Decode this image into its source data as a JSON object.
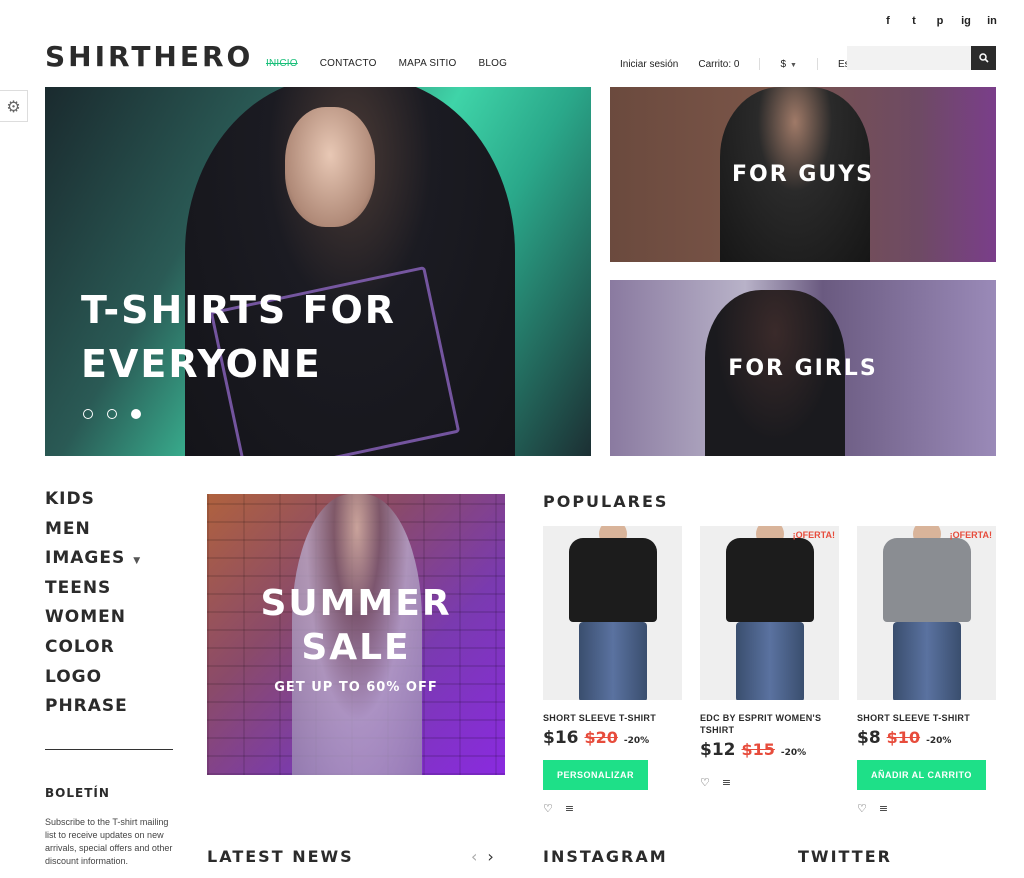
{
  "social": [
    "f",
    "t",
    "p",
    "ig",
    "in"
  ],
  "header": {
    "logo": "SHIRTHERO",
    "nav": [
      "INICIO",
      "CONTACTO",
      "MAPA SITIO",
      "BLOG"
    ],
    "login": "Iniciar sesión",
    "cart": "Carrito: 0",
    "currency": "$",
    "language": "Es",
    "search_placeholder": ""
  },
  "hero": {
    "title_line1": "T-SHIRTS FOR",
    "title_line2": "EVERYONE",
    "slides": 3,
    "active_slide": 3
  },
  "tiles": {
    "guys": "FOR GUYS",
    "girls": "FOR GIRLS"
  },
  "categories": [
    "KIDS",
    "MEN",
    "IMAGES",
    "TEENS",
    "WOMEN",
    "COLOR",
    "LOGO",
    "PHRASE"
  ],
  "newsletter": {
    "title": "BOLETÍN",
    "text": "Subscribe to the T-shirt mailing list to receive updates on new arrivals, special offers and other discount information."
  },
  "sale": {
    "line1": "SUMMER",
    "line2": "SALE",
    "sub": "GET UP TO 60% OFF"
  },
  "populares": {
    "title": "POPULARES",
    "products": [
      {
        "name": "SHORT SLEEVE T-SHIRT",
        "price": "$16",
        "old": "$20",
        "discount": "-20%",
        "badge": "",
        "button": "PERSONALIZAR",
        "shirt_color": "#1c1c1c"
      },
      {
        "name": "EDC BY ESPRIT WOMEN'S TSHIRT",
        "price": "$12",
        "old": "$15",
        "discount": "-20%",
        "badge": "¡OFERTA!",
        "button": "",
        "shirt_color": "#1c1c1c"
      },
      {
        "name": "SHORT SLEEVE T-SHIRT",
        "price": "$8",
        "old": "$10",
        "discount": "-20%",
        "badge": "¡OFERTA!",
        "button": "AÑADIR AL CARRITO",
        "shirt_color": "#8a8d92"
      }
    ]
  },
  "sections": {
    "news": "LATEST NEWS",
    "instagram": "INSTAGRAM",
    "twitter": "TWITTER"
  },
  "colors": {
    "accent": "#1ee088",
    "sale_red": "#e74c3c"
  }
}
